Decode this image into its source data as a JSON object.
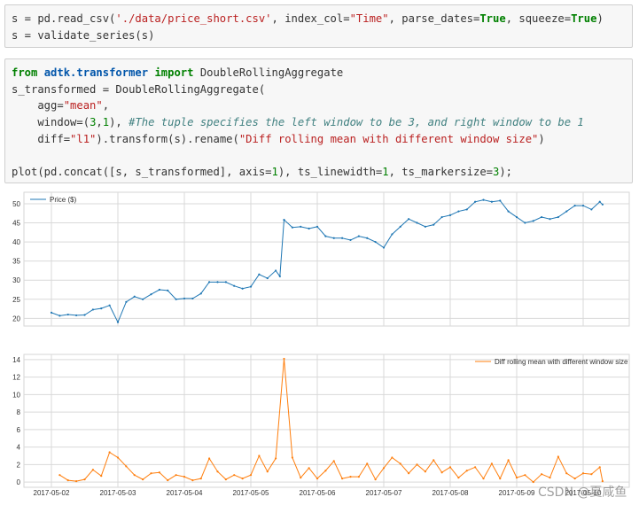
{
  "cells": [
    {
      "lines": [
        [
          [
            "t",
            "s = pd.read_csv("
          ],
          [
            "str",
            "'./data/price_short.csv'"
          ],
          [
            "t",
            ", index_col="
          ],
          [
            "str",
            "\"Time\""
          ],
          [
            "t",
            ", parse_dates="
          ],
          [
            "kw",
            "True"
          ],
          [
            "t",
            ", squeeze="
          ],
          [
            "kw",
            "True"
          ],
          [
            "t",
            ")"
          ]
        ],
        [
          [
            "t",
            "s = validate_series(s)"
          ]
        ]
      ]
    },
    {
      "lines": [
        [
          [
            "kw",
            "from"
          ],
          [
            "t",
            " "
          ],
          [
            "mod",
            "adtk.transformer"
          ],
          [
            "t",
            " "
          ],
          [
            "kw",
            "import"
          ],
          [
            "t",
            " DoubleRollingAggregate"
          ]
        ],
        [
          [
            "t",
            "s_transformed = DoubleRollingAggregate("
          ]
        ],
        [
          [
            "t",
            "    agg="
          ],
          [
            "str",
            "\"mean\""
          ],
          [
            "t",
            ","
          ]
        ],
        [
          [
            "t",
            "    window=("
          ],
          [
            "num",
            "3"
          ],
          [
            "t",
            ","
          ],
          [
            "num",
            "1"
          ],
          [
            "t",
            "), "
          ],
          [
            "cm",
            "#The tuple specifies the left window to be 3, and right window to be 1"
          ]
        ],
        [
          [
            "t",
            "    diff="
          ],
          [
            "str",
            "\"l1\""
          ],
          [
            "t",
            ").transform(s).rename("
          ],
          [
            "str",
            "\"Diff rolling mean with different window size\""
          ],
          [
            "t",
            ")"
          ]
        ],
        [
          [
            "t",
            ""
          ]
        ],
        [
          [
            "t",
            "plot(pd.concat([s, s_transformed], axis="
          ],
          [
            "num",
            "1"
          ],
          [
            "t",
            "), ts_linewidth="
          ],
          [
            "num",
            "1"
          ],
          [
            "t",
            ", ts_markersize="
          ],
          [
            "num",
            "3"
          ],
          [
            "t",
            ");"
          ]
        ]
      ]
    }
  ],
  "chart_data": [
    {
      "type": "line",
      "series": [
        {
          "name": "Price ($)",
          "color": "#1f77b4",
          "x": [
            "2017-05-02 00:00",
            "2017-05-02 03:00",
            "2017-05-02 06:00",
            "2017-05-02 09:00",
            "2017-05-02 12:00",
            "2017-05-02 15:00",
            "2017-05-02 18:00",
            "2017-05-02 21:00",
            "2017-05-03 00:00",
            "2017-05-03 03:00",
            "2017-05-03 06:00",
            "2017-05-03 09:00",
            "2017-05-03 12:00",
            "2017-05-03 15:00",
            "2017-05-03 18:00",
            "2017-05-03 21:00",
            "2017-05-04 00:00",
            "2017-05-04 03:00",
            "2017-05-04 06:00",
            "2017-05-04 09:00",
            "2017-05-04 12:00",
            "2017-05-04 15:00",
            "2017-05-04 18:00",
            "2017-05-04 21:00",
            "2017-05-05 00:00",
            "2017-05-05 03:00",
            "2017-05-05 06:00",
            "2017-05-05 09:00",
            "2017-05-05 10:30",
            "2017-05-05 12:00",
            "2017-05-05 15:00",
            "2017-05-05 18:00",
            "2017-05-05 21:00",
            "2017-05-06 00:00",
            "2017-05-06 03:00",
            "2017-05-06 06:00",
            "2017-05-06 09:00",
            "2017-05-06 12:00",
            "2017-05-06 15:00",
            "2017-05-06 18:00",
            "2017-05-06 21:00",
            "2017-05-07 00:00",
            "2017-05-07 03:00",
            "2017-05-07 06:00",
            "2017-05-07 09:00",
            "2017-05-07 12:00",
            "2017-05-07 15:00",
            "2017-05-07 18:00",
            "2017-05-07 21:00",
            "2017-05-08 00:00",
            "2017-05-08 03:00",
            "2017-05-08 06:00",
            "2017-05-08 09:00",
            "2017-05-08 12:00",
            "2017-05-08 15:00",
            "2017-05-08 18:00",
            "2017-05-08 21:00",
            "2017-05-09 00:00",
            "2017-05-09 03:00",
            "2017-05-09 06:00",
            "2017-05-09 09:00",
            "2017-05-09 12:00",
            "2017-05-09 15:00",
            "2017-05-09 18:00",
            "2017-05-09 21:00",
            "2017-05-10 00:00",
            "2017-05-10 03:00",
            "2017-05-10 06:00",
            "2017-05-10 07:00"
          ],
          "values": [
            21.5,
            20.7,
            21.0,
            20.8,
            20.9,
            22.3,
            22.6,
            23.4,
            19.0,
            24.3,
            25.7,
            25.0,
            26.3,
            27.5,
            27.3,
            25.0,
            25.2,
            25.2,
            26.5,
            29.5,
            29.5,
            29.5,
            28.5,
            27.8,
            28.3,
            31.5,
            30.5,
            32.5,
            31.0,
            45.8,
            43.8,
            44.0,
            43.5,
            44.0,
            41.5,
            41.0,
            41.0,
            40.5,
            41.5,
            41.0,
            40.0,
            38.5,
            42.0,
            44.0,
            46.0,
            45.0,
            44.0,
            44.5,
            46.5,
            47.0,
            48.0,
            48.5,
            50.5,
            51.0,
            50.5,
            50.8,
            48.0,
            46.5,
            45.0,
            45.5,
            46.5,
            46.0,
            46.5,
            48.0,
            49.5,
            49.5,
            48.5,
            50.5,
            49.8
          ]
        }
      ],
      "ylim": [
        18,
        53
      ],
      "yticks": [
        20,
        25,
        30,
        35,
        40,
        45,
        50
      ],
      "grid": true,
      "legend": "top-left"
    },
    {
      "type": "line",
      "series": [
        {
          "name": "Diff rolling mean with different window size",
          "color": "#ff7f0e",
          "x": [
            "2017-05-02 03:00",
            "2017-05-02 06:00",
            "2017-05-02 09:00",
            "2017-05-02 12:00",
            "2017-05-02 15:00",
            "2017-05-02 18:00",
            "2017-05-02 21:00",
            "2017-05-03 00:00",
            "2017-05-03 03:00",
            "2017-05-03 06:00",
            "2017-05-03 09:00",
            "2017-05-03 12:00",
            "2017-05-03 15:00",
            "2017-05-03 18:00",
            "2017-05-03 21:00",
            "2017-05-04 00:00",
            "2017-05-04 03:00",
            "2017-05-04 06:00",
            "2017-05-04 09:00",
            "2017-05-04 12:00",
            "2017-05-04 15:00",
            "2017-05-04 18:00",
            "2017-05-04 21:00",
            "2017-05-05 00:00",
            "2017-05-05 03:00",
            "2017-05-05 06:00",
            "2017-05-05 09:00",
            "2017-05-05 12:00",
            "2017-05-05 15:00",
            "2017-05-05 18:00",
            "2017-05-05 21:00",
            "2017-05-06 00:00",
            "2017-05-06 03:00",
            "2017-05-06 06:00",
            "2017-05-06 09:00",
            "2017-05-06 12:00",
            "2017-05-06 15:00",
            "2017-05-06 18:00",
            "2017-05-06 21:00",
            "2017-05-07 00:00",
            "2017-05-07 03:00",
            "2017-05-07 06:00",
            "2017-05-07 09:00",
            "2017-05-07 12:00",
            "2017-05-07 15:00",
            "2017-05-07 18:00",
            "2017-05-07 21:00",
            "2017-05-08 00:00",
            "2017-05-08 03:00",
            "2017-05-08 06:00",
            "2017-05-08 09:00",
            "2017-05-08 12:00",
            "2017-05-08 15:00",
            "2017-05-08 18:00",
            "2017-05-08 21:00",
            "2017-05-09 00:00",
            "2017-05-09 03:00",
            "2017-05-09 06:00",
            "2017-05-09 09:00",
            "2017-05-09 12:00",
            "2017-05-09 15:00",
            "2017-05-09 18:00",
            "2017-05-09 21:00",
            "2017-05-10 00:00",
            "2017-05-10 03:00",
            "2017-05-10 06:00",
            "2017-05-10 07:00"
          ],
          "values": [
            0.8,
            0.2,
            0.1,
            0.3,
            1.4,
            0.7,
            3.4,
            2.8,
            1.8,
            0.8,
            0.3,
            1.0,
            1.1,
            0.2,
            0.8,
            0.6,
            0.2,
            0.4,
            2.7,
            1.2,
            0.3,
            0.8,
            0.4,
            0.8,
            3.0,
            1.2,
            2.7,
            14.1,
            2.8,
            0.5,
            1.6,
            0.4,
            1.3,
            2.4,
            0.4,
            0.6,
            0.6,
            2.1,
            0.3,
            1.6,
            2.8,
            2.1,
            1.0,
            2.0,
            1.2,
            2.5,
            1.1,
            1.7,
            0.5,
            1.3,
            1.7,
            0.4,
            2.1,
            0.4,
            2.5,
            0.5,
            0.8,
            0.0,
            0.9,
            0.5,
            2.9,
            1.0,
            0.4,
            1.0,
            0.9,
            1.7,
            0.1
          ]
        }
      ],
      "ylim": [
        -0.6,
        14.6
      ],
      "yticks": [
        0,
        2,
        4,
        6,
        8,
        10,
        12,
        14
      ],
      "grid": true,
      "legend": "top-right",
      "xticks": [
        "2017-05-02",
        "2017-05-03",
        "2017-05-04",
        "2017-05-05",
        "2017-05-06",
        "2017-05-07",
        "2017-05-08",
        "2017-05-09",
        "2017-05-10"
      ]
    }
  ],
  "watermark": "CSDN @夏咸鱼"
}
